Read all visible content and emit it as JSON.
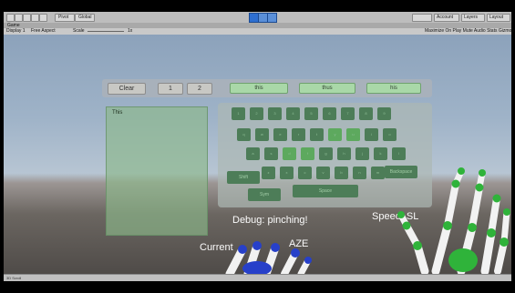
{
  "window": {
    "toolbar_labels": [
      "Pivot",
      "Global"
    ],
    "right_labels": [
      "Account",
      "Layers",
      "Layout"
    ],
    "game_tab": "Game",
    "display": "Display 1",
    "aspect": "Free Aspect",
    "scale_label": "Scale",
    "scale_value": "1x",
    "game_options": "Maximize On Play   Mute Audio   Stats   Gizmos"
  },
  "keyboard": {
    "clear_label": "Clear",
    "page1_label": "1",
    "page2_label": "2",
    "suggestions": [
      "this",
      "thus",
      "his"
    ],
    "typed_text": "This",
    "rows": [
      [
        "1",
        "2",
        "3",
        "4",
        "5",
        "6",
        "7",
        "8",
        "9"
      ],
      [
        "q",
        "w",
        "e",
        "r",
        "t",
        "y",
        "u",
        "i",
        "o"
      ],
      [
        "a",
        "s",
        "d",
        "f",
        "g",
        "h",
        "j",
        "k",
        "l"
      ],
      [
        "z",
        "x",
        "c",
        "v",
        "b",
        "n",
        "m"
      ]
    ],
    "shift_label": "Shift",
    "backspace_label": "Backspace",
    "sym_label": "Sym",
    "space_label": "Space"
  },
  "status": {
    "debug": "Debug: pinching!",
    "speed": "Speed: SL",
    "current": "Current",
    "current_tail": "AZE"
  },
  "statusbar": {
    "text": "3D Scroll"
  },
  "colors": {
    "key": "#4d7d58",
    "key_highlight": "#5da95e",
    "suggestion": "#a9d8a8"
  }
}
